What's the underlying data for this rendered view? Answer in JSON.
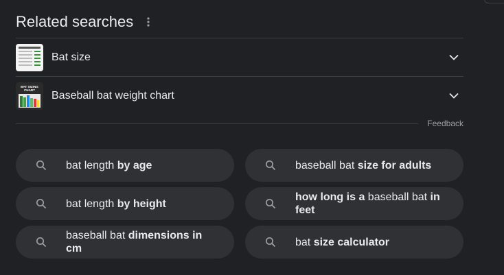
{
  "related": {
    "title": "Related searches",
    "more_icon": "more-vert-icon",
    "items": [
      {
        "label": "Bat size",
        "thumb": "bat-size-chart-thumbnail"
      },
      {
        "label": "Baseball bat weight chart",
        "thumb": "bat-sizing-chart-thumbnail",
        "thumb_caption": "BAT SIZING CHART"
      }
    ],
    "feedback": "Feedback"
  },
  "suggestions": [
    {
      "parts": [
        {
          "t": "bat length ",
          "b": false
        },
        {
          "t": "by age",
          "b": true
        }
      ]
    },
    {
      "parts": [
        {
          "t": "baseball bat ",
          "b": false
        },
        {
          "t": "size for adults",
          "b": true
        }
      ]
    },
    {
      "parts": [
        {
          "t": "bat length ",
          "b": false
        },
        {
          "t": "by height",
          "b": true
        }
      ]
    },
    {
      "parts": [
        {
          "t": "how long is a",
          "b": true
        },
        {
          "t": " baseball bat ",
          "b": false
        },
        {
          "t": "in feet",
          "b": true
        }
      ]
    },
    {
      "parts": [
        {
          "t": "baseball bat ",
          "b": false
        },
        {
          "t": "dimensions in cm",
          "b": true
        }
      ]
    },
    {
      "parts": [
        {
          "t": "bat ",
          "b": false
        },
        {
          "t": "size calculator",
          "b": true
        }
      ]
    }
  ],
  "colors": {
    "background": "#202124",
    "pill": "#303134",
    "text": "#e8eaed",
    "muted": "#9aa0a6",
    "divider": "#3c4043"
  }
}
